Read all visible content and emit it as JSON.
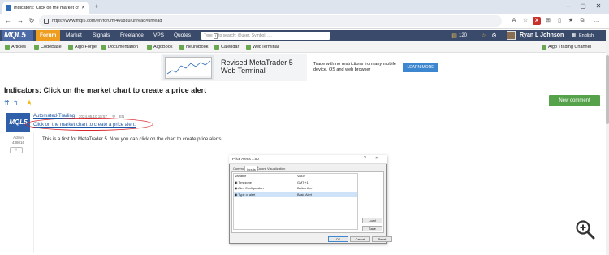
{
  "browser": {
    "tab_title": "Indicators: Click on the market ch...",
    "url": "https://www.mql5.com/en/forum/466889/unread#unread"
  },
  "site": {
    "logo": "MQL5",
    "nav": [
      "Forum",
      "Market",
      "Signals",
      "Freelance",
      "VPS",
      "Quotes"
    ],
    "search_placeholder_a": "Type",
    "search_key": "/",
    "search_placeholder_b": "to search: @user, Symbol, ....",
    "coins": "120",
    "username": "Ryan L Johnson",
    "language": "English"
  },
  "subnav": {
    "items": [
      "Articles",
      "CodeBase",
      "Algo Forge",
      "Documentation",
      "AlgoBook",
      "NeuroBook",
      "Calendar",
      "WebTerminal"
    ],
    "right": "Algo Trading Channel"
  },
  "banner": {
    "title_line1": "Revised MetaTrader 5",
    "title_line2": "Web Terminal",
    "desc": "Trade with no restrictions from any mobile device, OS and web browser",
    "button": "LEARN MORE"
  },
  "page": {
    "title": "Indicators: Click on the market chart to create a price alert",
    "new_comment": "New comment"
  },
  "post": {
    "avatar_text": "MQL5",
    "role": "Admin",
    "id": "438016",
    "plus": "+",
    "author": "Automated-Trading",
    "date": "2024.05.10 18:57",
    "lang": "EN",
    "link": "Click on the market chart to create a price alert:",
    "body": "This is a first for MetaTrader 5. Now you can click on the chart to create price alerts."
  },
  "dialog": {
    "title": "Price Alerts 1.00",
    "tabs": [
      "Common",
      "Inputs",
      "Colors",
      "Visualization"
    ],
    "active_tab": "Inputs",
    "col_variable": "Variable",
    "col_value": "Value",
    "rows": [
      {
        "var": "Timezone",
        "val": "GMT +1"
      },
      {
        "var": "Alert Configuration",
        "val": "Button Alert"
      },
      {
        "var": "Type of alert",
        "val": "Basic Alert"
      }
    ],
    "load": "Load",
    "save": "Save",
    "ok": "OK",
    "cancel": "Cancel",
    "reset": "Reset"
  }
}
